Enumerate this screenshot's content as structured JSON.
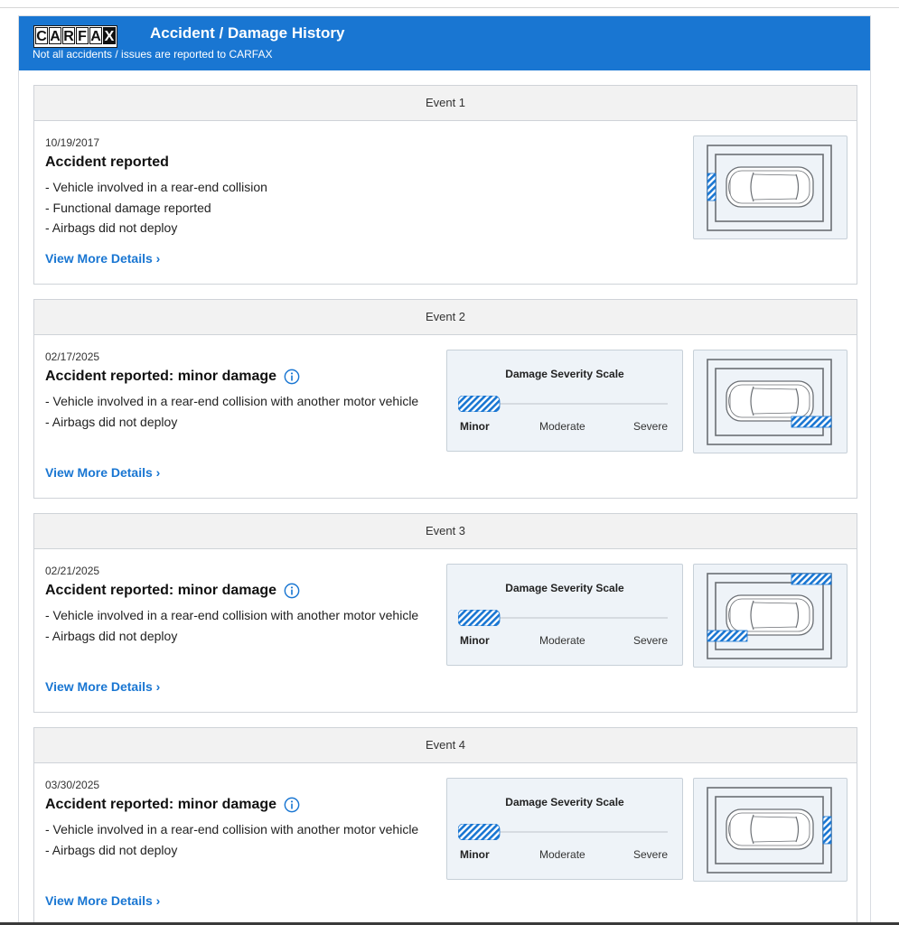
{
  "header": {
    "logo_letters": [
      "C",
      "A",
      "R",
      "F",
      "A",
      "X"
    ],
    "title": "Accident / Damage History",
    "subtitle": "Not all accidents / issues are reported to CARFAX",
    "brand_color": "#1976d2"
  },
  "events": [
    {
      "label": "Event 1",
      "date": "10/19/2017",
      "title": "Accident reported",
      "lines": [
        "- Vehicle involved in a rear-end collision",
        "- Functional damage reported",
        "- Airbags did not deploy"
      ],
      "link": "View More Details ›",
      "damage_zones": [
        "left-center"
      ]
    },
    {
      "label": "Event 2",
      "date": "02/17/2025",
      "title": "Accident reported: minor damage",
      "lines": [
        "- Vehicle involved in a rear-end collision with another motor vehicle",
        "- Airbags did not deploy"
      ],
      "link": "View More Details ›",
      "severity_scale": {
        "title": "Damage Severity Scale",
        "level": "Minor",
        "labels": [
          "Minor",
          "Moderate",
          "Severe"
        ]
      },
      "damage_zones": [
        "right-bottom"
      ]
    },
    {
      "label": "Event 3",
      "date": "02/21/2025",
      "title": "Accident reported: minor damage",
      "lines": [
        "- Vehicle involved in a rear-end collision with another motor vehicle",
        "- Airbags did not deploy"
      ],
      "link": "View More Details ›",
      "severity_scale": {
        "title": "Damage Severity Scale",
        "level": "Minor",
        "labels": [
          "Minor",
          "Moderate",
          "Severe"
        ]
      },
      "damage_zones": [
        "right-top",
        "left-bottom"
      ]
    },
    {
      "label": "Event 4",
      "date": "03/30/2025",
      "title": "Accident reported: minor damage",
      "lines": [
        "- Vehicle involved in a rear-end collision with another motor vehicle",
        "- Airbags did not deploy"
      ],
      "link": "View More Details ›",
      "severity_scale": {
        "title": "Damage Severity Scale",
        "level": "Minor",
        "labels": [
          "Minor",
          "Moderate",
          "Severe"
        ]
      },
      "damage_zones": [
        "right-center"
      ]
    }
  ]
}
